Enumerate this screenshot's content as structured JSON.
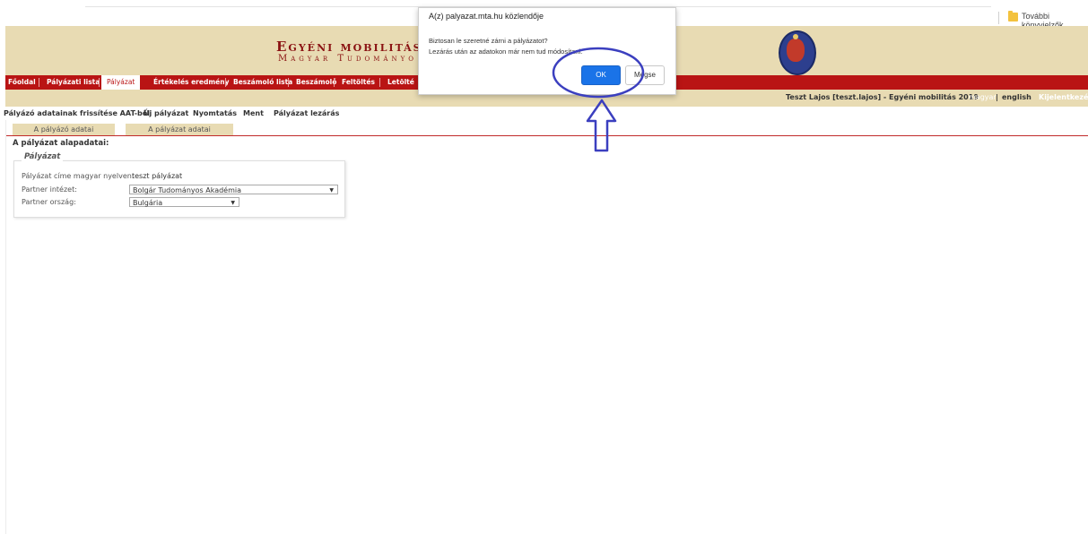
{
  "browser": {
    "bookmarks_folder_label": "További könyvjelzők",
    "colors": {
      "folder": "#f3c23e"
    }
  },
  "header": {
    "title_line1": "Egyéni mobilitás",
    "title_line2": "Magyar Tudományo",
    "logo_icon": "academy-crest-icon",
    "colors": {
      "banner": "#e8dbb3",
      "title": "#8a1212"
    }
  },
  "nav": {
    "items": [
      {
        "label": "Főoldal",
        "active": false
      },
      {
        "label": "Pályázati lista",
        "active": false
      },
      {
        "label": "Pályázat",
        "active": true
      },
      {
        "label": "Értékelés eredmény",
        "active": false
      },
      {
        "label": "Beszámoló lista",
        "active": false
      },
      {
        "label": "Beszámoló",
        "active": false
      },
      {
        "label": "Feltöltés",
        "active": false
      },
      {
        "label": "Letölté",
        "active": false
      }
    ],
    "colors": {
      "bar": "#b91414"
    }
  },
  "userbar": {
    "user": "Teszt Lajos [teszt.lajos] - Egyéni mobilitás 2019",
    "lang_hu": "magyar",
    "lang_sep": "|",
    "lang_en": "english",
    "logout": "Kijelentkezés"
  },
  "toolbar": {
    "items": [
      "Pályázó adatainak frissítése AAT-ből",
      "Új pályázat",
      "Nyomtatás",
      "Ment",
      "Pályázat lezárás"
    ]
  },
  "tabs": [
    {
      "label": "A pályázó adatai"
    },
    {
      "label": "A pályázat adatai"
    }
  ],
  "main": {
    "section_title": "A pályázat alapadatai:",
    "fieldset_legend": "Pályázat",
    "fields": [
      {
        "label": "Pályázat címe magyar nyelven:",
        "value": "teszt pályázat"
      },
      {
        "label": "Partner intézet:",
        "value": "Bolgár Tudományos Akadémia"
      },
      {
        "label": "Partner ország:",
        "value": "Bulgária"
      }
    ]
  },
  "dialog": {
    "title": "A(z) palyazat.mta.hu közlendője",
    "message_line1": "Biztosan le szeretné zárni a pályázatot?",
    "message_line2": "Lezárás után az adatokon már nem tud módosítani.",
    "ok_label": "OK",
    "cancel_label": "Mégse",
    "colors": {
      "ok": "#1a73e8"
    }
  },
  "annotation": {
    "icon": "up-arrow-icon",
    "highlight": "ok-button-circle",
    "color": "#3b3fbf"
  }
}
